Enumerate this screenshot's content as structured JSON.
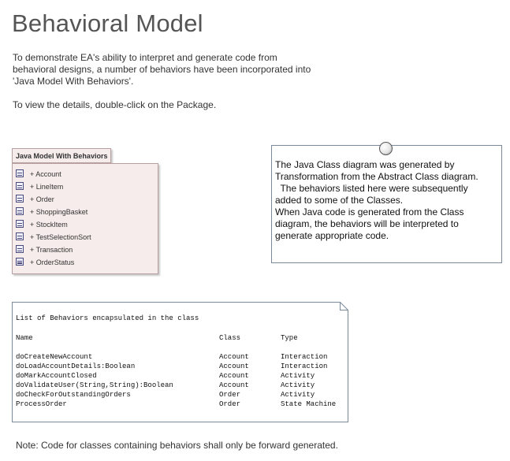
{
  "title": "Behavioral Model",
  "intro": {
    "line1": "To demonstrate EA's ability to interpret and generate code from",
    "line2": "behavioral designs, a number of behaviors have been incorporated into",
    "line3": "'Java Model With Behaviors'.",
    "line4": "To view the details, double-click on the Package."
  },
  "package": {
    "name": "Java Model With Behaviors",
    "items": [
      {
        "label": "+ Account",
        "icon": "class-icon"
      },
      {
        "label": "+ LineItem",
        "icon": "class-icon"
      },
      {
        "label": "+ Order",
        "icon": "class-icon"
      },
      {
        "label": "+ ShoppingBasket",
        "icon": "class-icon"
      },
      {
        "label": "+ StockItem",
        "icon": "class-icon"
      },
      {
        "label": "+ TestSelectionSort",
        "icon": "class-icon"
      },
      {
        "label": "+ Transaction",
        "icon": "class-icon"
      },
      {
        "label": "+ OrderStatus",
        "icon": "enumeration-icon"
      }
    ]
  },
  "note": {
    "lines": [
      "The Java Class diagram was generated by",
      "Transformation from the Abstract Class diagram.",
      "  The behaviors listed here were subsequently",
      "added to some of the Classes.",
      "When Java code is generated from the Class",
      "diagram, the behaviors will be interpreted to",
      "generate appropriate code."
    ]
  },
  "behaviors": {
    "title": "List of Behaviors encapsulated in the class",
    "headers": {
      "name": "Name",
      "class": "Class",
      "type": "Type"
    },
    "rows": [
      {
        "name": "doCreateNewAccount",
        "class": "Account",
        "type": "Interaction"
      },
      {
        "name": "doLoadAccountDetails:Boolean",
        "class": "Account",
        "type": "Interaction"
      },
      {
        "name": "doMarkAccountClosed",
        "class": "Account",
        "type": "Activity"
      },
      {
        "name": "doValidateUser(String,String):Boolean",
        "class": "Account",
        "type": "Activity"
      },
      {
        "name": "doCheckForOutstandingOrders",
        "class": "Order",
        "type": "Activity"
      },
      {
        "name": "ProcessOrder",
        "class": "Order",
        "type": "State Machine"
      }
    ]
  },
  "footnote": "Note: Code for classes containing behaviors shall only be forward generated."
}
